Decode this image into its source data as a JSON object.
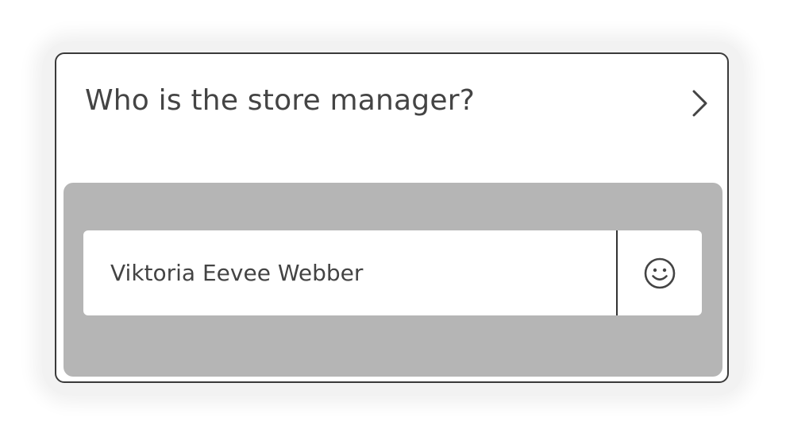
{
  "question": {
    "text": "Who is the store manager?",
    "next_icon": "chevron-right-icon"
  },
  "answer": {
    "value": "Viktoria Eevee Webber",
    "emoji_icon": "smiley-face-icon"
  },
  "colors": {
    "card_border": "#3a3a3a",
    "answer_panel_bg": "#b5b5b5",
    "text": "#444444"
  }
}
